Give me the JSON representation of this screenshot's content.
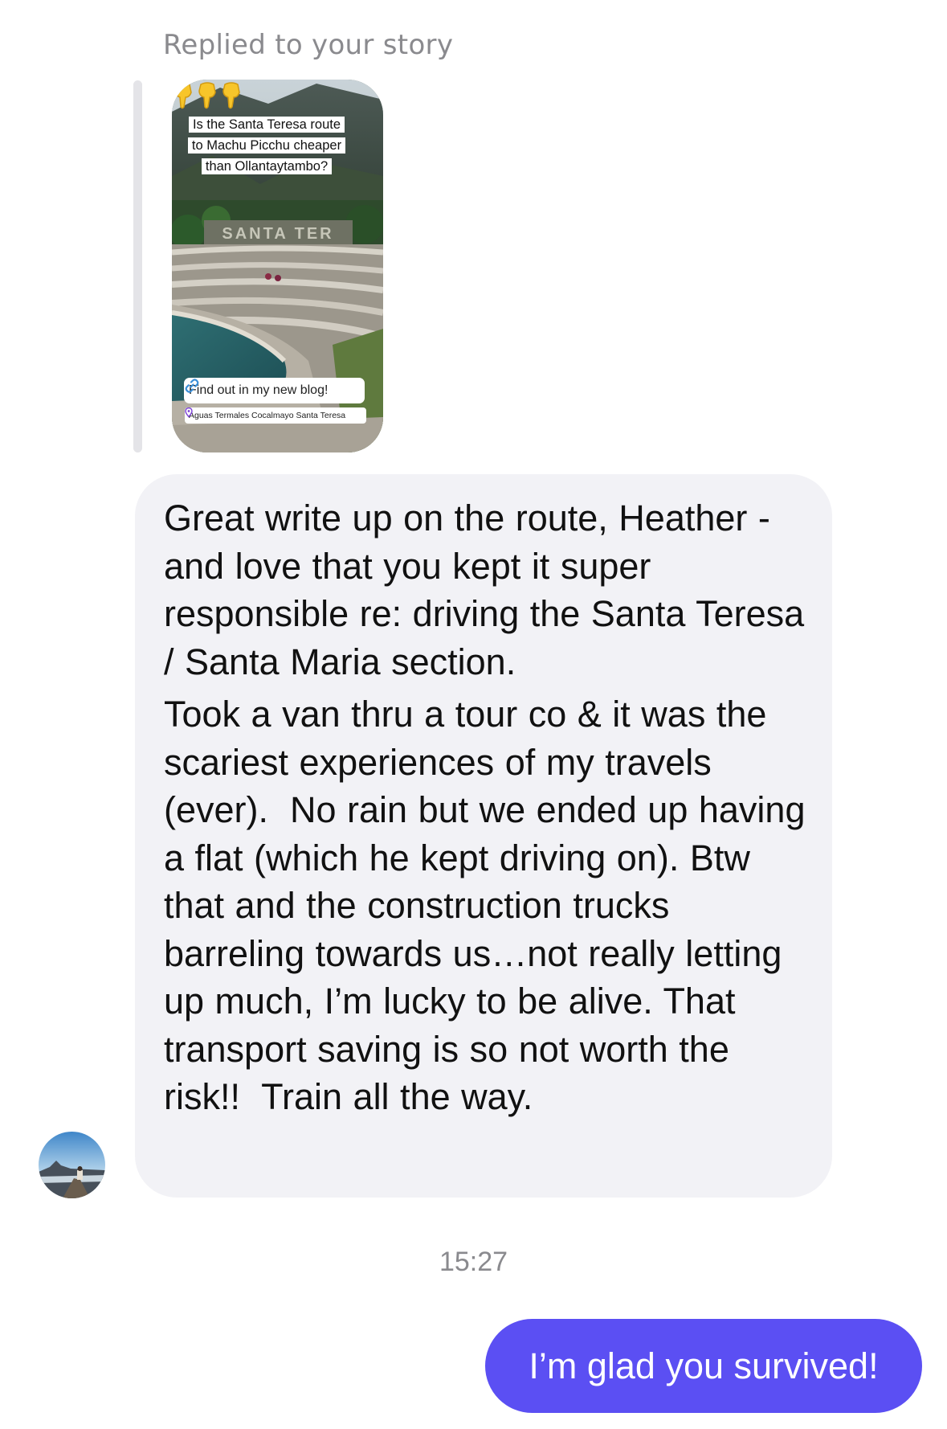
{
  "reply_header": "Replied to your story",
  "story": {
    "question": "Is the Santa Teresa route to Machu Picchu cheaper than Ollantaytambo?",
    "link_icon": "link-icon",
    "link_text": "Find out in my new blog!",
    "location_icon": "location-pin-icon",
    "location_text": "Aguas Termales Cocalmayo Santa Teresa",
    "emoji": "pointing-down-hand-emoji"
  },
  "incoming_message": {
    "paragraphs": [
      "Great write up on the route, Heather - and love that you kept it super responsible re: driving the Santa Teresa / Santa Maria section.",
      "Took a van thru a tour co & it was the scariest experiences of my travels (ever).  No rain but we ended up having a flat (which he kept driving on). Btw that and the construction trucks barreling towards us…not really letting up much, I’m lucky to be alive. That transport saving is so not worth the risk!!  Train all the way."
    ]
  },
  "timestamp": "15:27",
  "outgoing_message": {
    "text": "I’m glad you survived!"
  },
  "colors": {
    "sent_bubble": "#5b4ff3",
    "received_bubble": "#f2f2f6",
    "meta_text": "#8a8a8e"
  }
}
